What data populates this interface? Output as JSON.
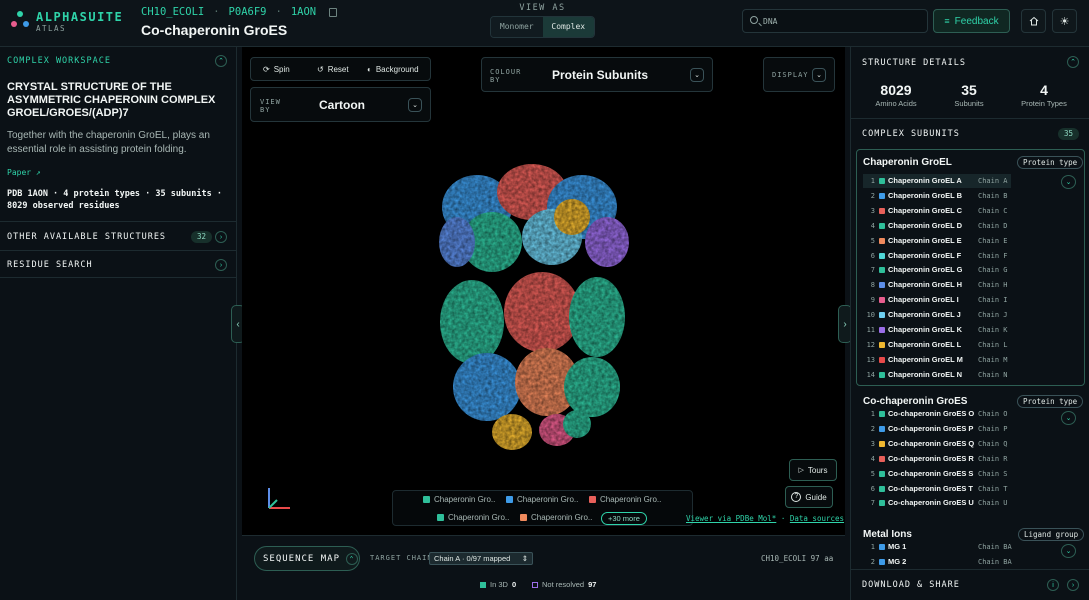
{
  "header": {
    "brand": "ALPHASUITE",
    "brand_sub": "ATLAS",
    "ids": [
      "CH10_ECOLI",
      "P0A6F9",
      "1AON"
    ],
    "title": "Co-chaperonin GroES",
    "view_as_label": "VIEW AS",
    "view_as_options": [
      "Monomer",
      "Complex"
    ],
    "view_as_selected": "Complex",
    "search_value": "DNA",
    "feedback_label": "Feedback"
  },
  "left": {
    "workspace_label": "COMPLEX WORKSPACE",
    "structure_title": "CRYSTAL STRUCTURE OF THE ASYMMETRIC CHAPERONIN COMPLEX GROEL/GROES/(ADP)7",
    "description": "Together with the chaperonin GroEL, plays an essential role in assisting protein folding.",
    "paper_label": "Paper ↗",
    "pdb_summary": "PDB 1AON · 4 protein types · 35 subunits · 8029 observed residues",
    "other_structures_label": "OTHER AVAILABLE STRUCTURES",
    "other_structures_count": "32",
    "residue_search_label": "RESIDUE SEARCH"
  },
  "viewer": {
    "spin_label": "Spin",
    "reset_label": "Reset",
    "background_label": "Background",
    "view_by_label": "VIEW BY",
    "view_by_value": "Cartoon",
    "colour_by_label": "COLOUR BY",
    "colour_by_value": "Protein Subunits",
    "display_label": "DISPLAY",
    "legend": [
      {
        "label": "Chaperonin Gro..",
        "color": "#2fbf9a"
      },
      {
        "label": "Chaperonin Gro..",
        "color": "#3e9be8"
      },
      {
        "label": "Chaperonin Gro..",
        "color": "#e8605a"
      },
      {
        "label": "Chaperonin Gro..",
        "color": "#2fbf9a"
      },
      {
        "label": "Chaperonin Gro..",
        "color": "#f08a5d"
      }
    ],
    "more_label": "+30 more",
    "tours_label": "Tours",
    "guide_label": "Guide",
    "viewer_link": "Viewer via PDBe Mol*",
    "data_link": "Data sources"
  },
  "sequence": {
    "map_label": "SEQUENCE MAP",
    "target_chain_label": "TARGET CHAIN",
    "target_chain_value": "Chain A · 0/97 mapped",
    "chain_info": "CH10_ECOLI 97 aa",
    "in3d_label": "In 3D",
    "in3d_count": "0",
    "not_resolved_label": "Not resolved",
    "not_resolved_count": "97"
  },
  "right": {
    "details_label": "STRUCTURE DETAILS",
    "stats": [
      {
        "value": "8029",
        "label": "Amino Acids"
      },
      {
        "value": "35",
        "label": "Subunits"
      },
      {
        "value": "4",
        "label": "Protein Types"
      }
    ],
    "subunits_label": "COMPLEX SUBUNITS",
    "subunits_count": "35",
    "groups": [
      {
        "title": "Chaperonin GroEL",
        "type": "Protein type",
        "rows": [
          {
            "n": "1",
            "name": "Chaperonin GroEL A",
            "chain": "Chain A",
            "color": "#2fbf9a"
          },
          {
            "n": "2",
            "name": "Chaperonin GroEL B",
            "chain": "Chain B",
            "color": "#3e9be8"
          },
          {
            "n": "3",
            "name": "Chaperonin GroEL C",
            "chain": "Chain C",
            "color": "#e8605a"
          },
          {
            "n": "4",
            "name": "Chaperonin GroEL D",
            "chain": "Chain D",
            "color": "#2fbf9a"
          },
          {
            "n": "5",
            "name": "Chaperonin GroEL E",
            "chain": "Chain E",
            "color": "#f08a5d"
          },
          {
            "n": "6",
            "name": "Chaperonin GroEL F",
            "chain": "Chain F",
            "color": "#4fd6d6"
          },
          {
            "n": "7",
            "name": "Chaperonin GroEL G",
            "chain": "Chain G",
            "color": "#2fbf9a"
          },
          {
            "n": "8",
            "name": "Chaperonin GroEL H",
            "chain": "Chain H",
            "color": "#5d8ee8"
          },
          {
            "n": "9",
            "name": "Chaperonin GroEL I",
            "chain": "Chain I",
            "color": "#e85d8e"
          },
          {
            "n": "10",
            "name": "Chaperonin GroEL J",
            "chain": "Chain J",
            "color": "#6ecff0"
          },
          {
            "n": "11",
            "name": "Chaperonin GroEL K",
            "chain": "Chain K",
            "color": "#9b6ee8"
          },
          {
            "n": "12",
            "name": "Chaperonin GroEL L",
            "chain": "Chain L",
            "color": "#f0b830"
          },
          {
            "n": "13",
            "name": "Chaperonin GroEL M",
            "chain": "Chain M",
            "color": "#e84a4a"
          },
          {
            "n": "14",
            "name": "Chaperonin GroEL N",
            "chain": "Chain N",
            "color": "#2fbf9a"
          }
        ]
      },
      {
        "title": "Co-chaperonin GroES",
        "type": "Protein type",
        "rows": [
          {
            "n": "1",
            "name": "Co-chaperonin GroES O",
            "chain": "Chain O",
            "color": "#2fbf9a"
          },
          {
            "n": "2",
            "name": "Co-chaperonin GroES P",
            "chain": "Chain P",
            "color": "#3e9be8"
          },
          {
            "n": "3",
            "name": "Co-chaperonin GroES Q",
            "chain": "Chain Q",
            "color": "#f0b830"
          },
          {
            "n": "4",
            "name": "Co-chaperonin GroES R",
            "chain": "Chain R",
            "color": "#e8605a"
          },
          {
            "n": "5",
            "name": "Co-chaperonin GroES S",
            "chain": "Chain S",
            "color": "#2fbf9a"
          },
          {
            "n": "6",
            "name": "Co-chaperonin GroES T",
            "chain": "Chain T",
            "color": "#2fbf9a"
          },
          {
            "n": "7",
            "name": "Co-chaperonin GroES U",
            "chain": "Chain U",
            "color": "#2fbf9a"
          }
        ]
      },
      {
        "title": "Metal Ions",
        "type": "Ligand group",
        "rows": [
          {
            "n": "1",
            "name": "MG 1",
            "chain": "Chain BA",
            "color": "#3e9be8"
          },
          {
            "n": "2",
            "name": "MG 2",
            "chain": "Chain BA",
            "color": "#3e9be8"
          }
        ]
      }
    ],
    "download_label": "DOWNLOAD & SHARE"
  }
}
